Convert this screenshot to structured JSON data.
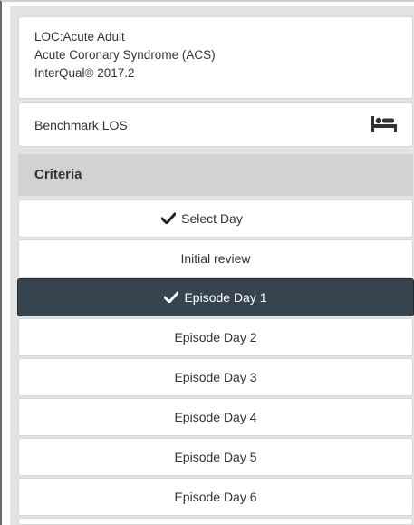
{
  "header": {
    "line1": "LOC:Acute Adult",
    "line2": "Acute Coronary Syndrome (ACS)",
    "line3": "InterQual® 2017.2"
  },
  "benchmark": {
    "label": "Benchmark LOS",
    "icon": "bed-icon"
  },
  "criteria": {
    "label": "Criteria"
  },
  "days": [
    {
      "label": "Select Day",
      "checked": true,
      "active": false
    },
    {
      "label": "Initial review",
      "checked": false,
      "active": false
    },
    {
      "label": "Episode Day 1",
      "checked": true,
      "active": true
    },
    {
      "label": "Episode Day 2",
      "checked": false,
      "active": false
    },
    {
      "label": "Episode Day 3",
      "checked": false,
      "active": false
    },
    {
      "label": "Episode Day 4",
      "checked": false,
      "active": false
    },
    {
      "label": "Episode Day 5",
      "checked": false,
      "active": false
    },
    {
      "label": "Episode Day 6",
      "checked": false,
      "active": false
    }
  ],
  "colors": {
    "active_bg": "#35444e",
    "panel_bg": "#e3e3e3",
    "criteria_bg": "#d2d2d2"
  }
}
